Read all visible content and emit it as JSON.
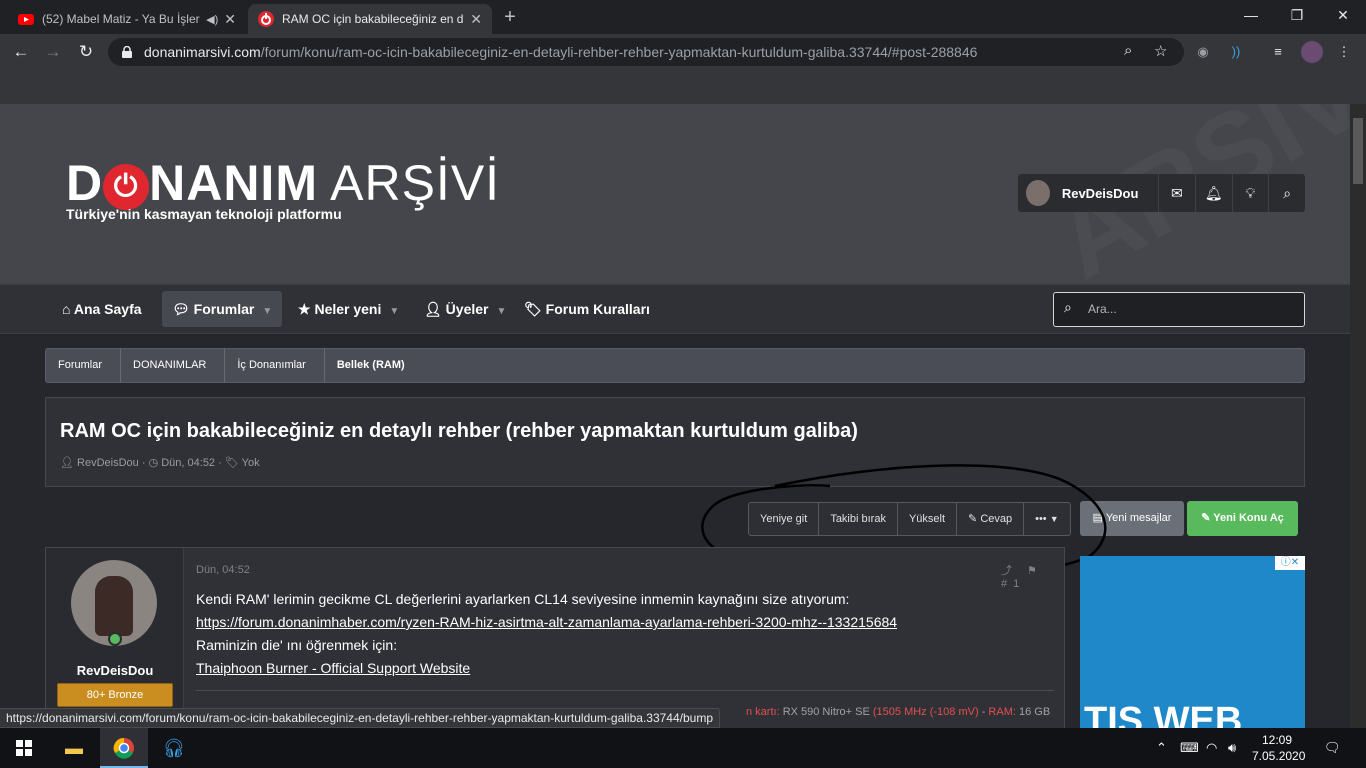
{
  "browser": {
    "tabs": [
      {
        "title": "(52) Mabel Matiz - Ya Bu İşler",
        "close": "✕"
      },
      {
        "title": "RAM OC için bakabileceğiniz en d",
        "close": "✕"
      }
    ],
    "new_tab": "+",
    "window_controls": [
      "—",
      "❐",
      "✕"
    ],
    "url_host": "donanimarsivi.com",
    "url_path": "/forum/konu/ram-oc-icin-bakabileceginiz-en-detayli-rehber-rehber-yapmaktan-kurtuldum-galiba.33744/#post-288846",
    "status_url": "https://donanimarsivi.com/forum/konu/ram-oc-icin-bakabileceginiz-en-detayli-rehber-rehber-yapmaktan-kurtuldum-galiba.33744/bump"
  },
  "site": {
    "logo_d": "D",
    "logo_nanim": "NANIM",
    "logo_arsivi": " ARŞİVİ",
    "tagline": "Türkiye'nin kasmayan teknoloji platformu",
    "username": "RevDeisDou"
  },
  "nav": {
    "items": [
      {
        "label": "Ana Sayfa"
      },
      {
        "label": "Forumlar"
      },
      {
        "label": "Neler yeni"
      },
      {
        "label": "Üyeler"
      },
      {
        "label": "Forum Kuralları"
      }
    ],
    "search_placeholder": "Ara..."
  },
  "breadcrumb": [
    "Forumlar",
    "DONANIMLAR",
    "İç Donanımlar",
    "Bellek (RAM)"
  ],
  "thread": {
    "title": "RAM OC için bakabileceğiniz en detaylı rehber (rehber yapmaktan kurtuldum galiba)",
    "author": "RevDeisDou",
    "date": "Dün, 04:52",
    "tags": "Yok"
  },
  "actions": {
    "goto_new": "Yeniye git",
    "unwatch": "Takibi bırak",
    "bump": "Yükselt",
    "reply": "Cevap",
    "more": "•••",
    "new_posts": "Yeni mesajlar",
    "new_topic": "Yeni Konu Aç"
  },
  "post": {
    "date": "Dün, 04:52",
    "author": "RevDeisDou",
    "badge": "80+ Bronze",
    "line1": "Kendi RAM' lerimin gecikme CL değerlerini ayarlarken CL14 seviyesine inmemin kaynağını size atıyorum:",
    "link1": "https://forum.donanimhaber.com/ryzen-RAM-hiz-asirtma-alt-zamanlama-ayarlama-rehberi-3200-mhz--133215684",
    "line2": "Raminizin die' ını öğrenmek için:",
    "link2": "Thaiphoon Burner - Official Support Website",
    "sig_red1": "n kartı: ",
    "sig_plain1": "RX 590 Nitro+ SE ",
    "sig_red2": "(1505 MHz (-108 mV)",
    "sig_plain2": " - ",
    "sig_red3": "RAM: ",
    "sig_plain3": "16 GB"
  },
  "ad": {
    "text": "TIS WEB",
    "badge": "ⓘ✕"
  },
  "taskbar": {
    "time": "12:09",
    "date": "7.05.2020"
  },
  "colors": {
    "accent_red": "#e0262e",
    "button_green": "#58b95d",
    "badge_bronze": "#c98e1f"
  }
}
